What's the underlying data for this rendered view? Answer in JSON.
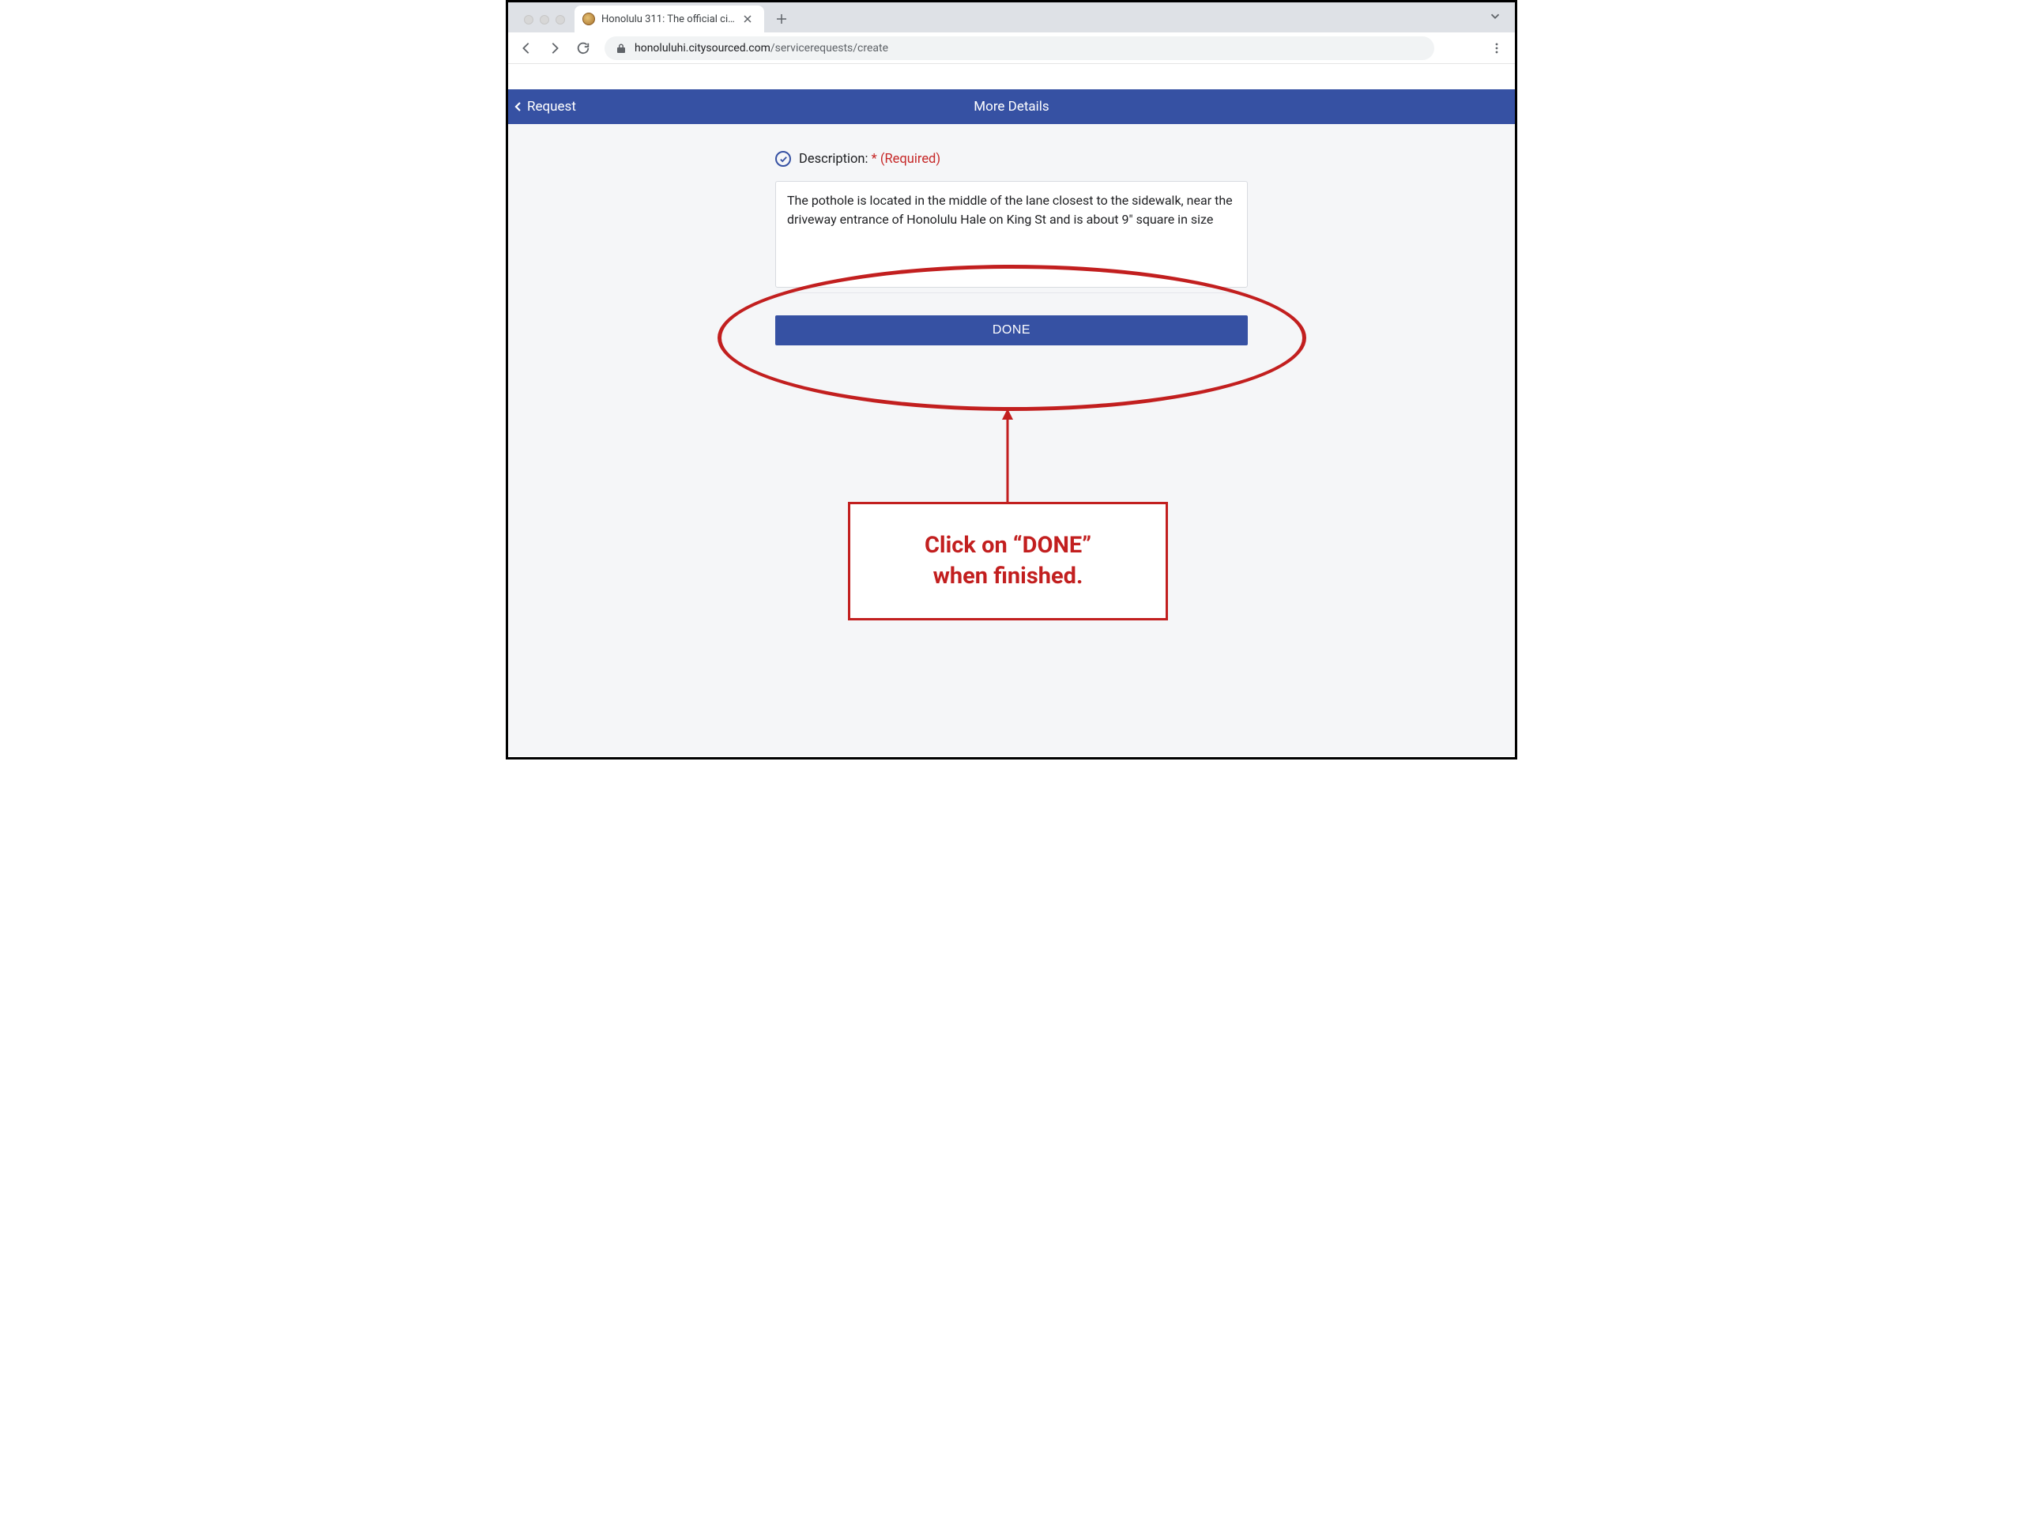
{
  "browser": {
    "tab_title": "Honolulu 311: The official citize",
    "url_host": "honoluluhi.citysourced.com",
    "url_path": "/servicerequests/create"
  },
  "app_bar": {
    "back_label": "Request",
    "title": "More Details"
  },
  "form": {
    "description_label": "Description: ",
    "required_marker": "* (Required)",
    "description_value": "The pothole is located in the middle of the lane closest to the sidewalk, near the driveway entrance of Honolulu Hale on King St and is about 9\" square in size",
    "done_label": "DONE"
  },
  "annotation": {
    "callout_line1": "Click on “DONE”",
    "callout_line2": "when  finished."
  }
}
